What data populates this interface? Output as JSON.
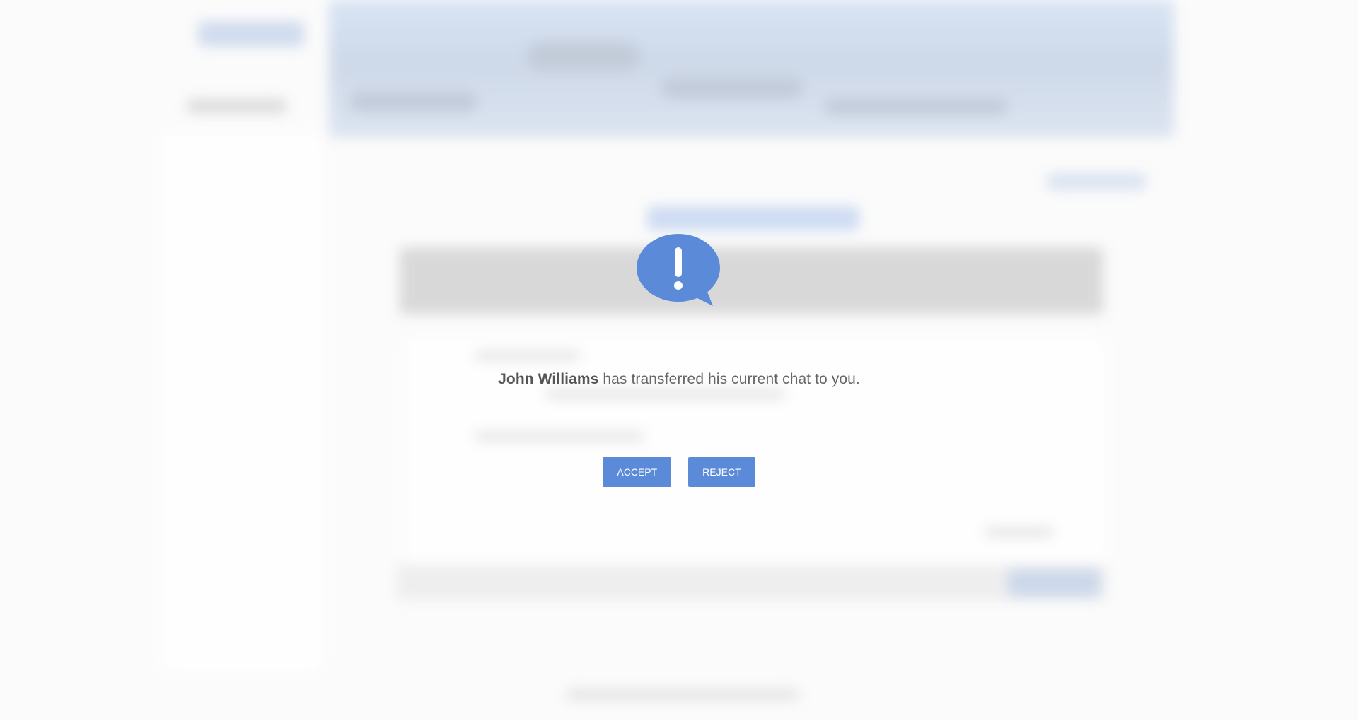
{
  "dialog": {
    "sender_name": "John Williams",
    "message_text": " has transferred his current chat to you.",
    "icon": "alert-speech-bubble-icon",
    "accept_label": "ACCEPT",
    "reject_label": "REJECT"
  },
  "colors": {
    "accent": "#5b8bd8",
    "text": "#666666",
    "background": "#fbfbfb"
  }
}
